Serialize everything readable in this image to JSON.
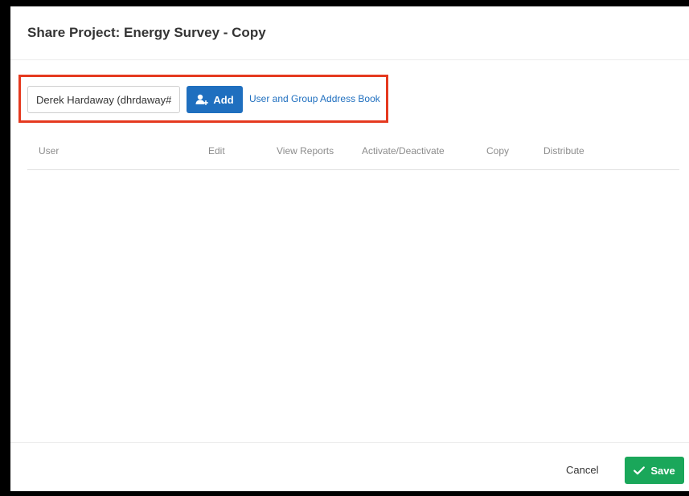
{
  "dialog": {
    "title": "Share Project: Energy Survey - Copy"
  },
  "share_form": {
    "user_input_value": "Derek Hardaway (dhrdaway#",
    "add_label": "Add",
    "address_book_label": "User and Group Address Book",
    "add_icon": "add-user-icon"
  },
  "table": {
    "columns": [
      "User",
      "Edit",
      "View Reports",
      "Activate/Deactivate",
      "Copy",
      "Distribute"
    ]
  },
  "footer": {
    "cancel_label": "Cancel",
    "save_label": "Save",
    "save_icon": "checkmark-icon"
  },
  "colors": {
    "primary_blue": "#1f6fbf",
    "save_green": "#1aa75a",
    "highlight_red": "#e5391f"
  }
}
